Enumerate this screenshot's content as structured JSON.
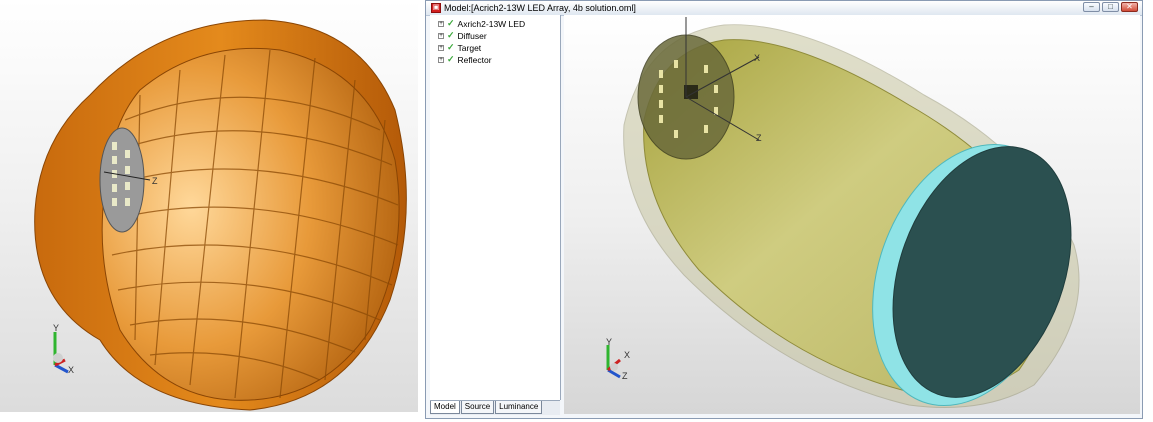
{
  "window": {
    "title": "Model:[Acrich2-13W LED Array, 4b solution.oml]",
    "app_icon": "oml-app-icon",
    "controls": [
      "minimize",
      "maximize",
      "close"
    ]
  },
  "tree": {
    "items": [
      {
        "label": "Axrich2-13W LED",
        "checked": true
      },
      {
        "label": "Diffuser",
        "checked": true
      },
      {
        "label": "Target",
        "checked": true
      },
      {
        "label": "Reflector",
        "checked": true
      }
    ]
  },
  "tabs": [
    {
      "label": "Model",
      "active": true
    },
    {
      "label": "Source",
      "active": false
    },
    {
      "label": "Luminance",
      "active": false
    }
  ],
  "left_view": {
    "axis_labels": {
      "y": "Y",
      "x": "X",
      "z": "Z"
    },
    "reflector_color": "#d77b12"
  },
  "right_view": {
    "axis_labels": {
      "y": "Y",
      "x": "X",
      "z": "Z"
    },
    "diffuser_color": "#b5b24e",
    "target_color": "#2b5050",
    "rim_color": "#8fe3e6"
  },
  "colors": {
    "tree_check": "#3aa83a",
    "window_border": "#8a9bb3",
    "close_button": "#d14b37"
  }
}
